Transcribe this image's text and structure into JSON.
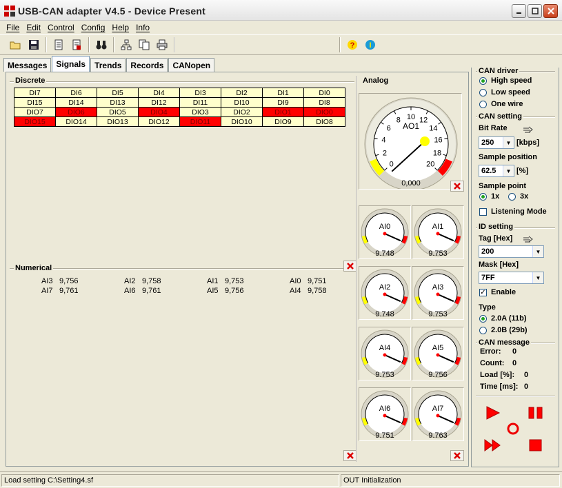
{
  "window": {
    "title": "USB-CAN adapter  V4.5  -  Device Present"
  },
  "menu": [
    "File",
    "Edit",
    "Control",
    "Config",
    "Help",
    "Info"
  ],
  "toolbar_icons": [
    "open-folder-icon",
    "save-icon",
    "open-doc-icon",
    "new-doc-icon",
    "binoculars-icon",
    "tree-icon",
    "copy-icon",
    "print-icon",
    "help-icon",
    "info-icon"
  ],
  "tabs": [
    "Messages",
    "Signals",
    "Trends",
    "Records",
    "CANopen"
  ],
  "active_tab": "Signals",
  "discrete": {
    "label": "Discrete",
    "rows": [
      [
        {
          "t": "DI7",
          "on": false
        },
        {
          "t": "DI6",
          "on": false
        },
        {
          "t": "DI5",
          "on": false
        },
        {
          "t": "DI4",
          "on": false
        },
        {
          "t": "DI3",
          "on": false
        },
        {
          "t": "DI2",
          "on": false
        },
        {
          "t": "DI1",
          "on": false
        },
        {
          "t": "DI0",
          "on": false
        }
      ],
      [
        {
          "t": "DI15",
          "on": false
        },
        {
          "t": "DI14",
          "on": false
        },
        {
          "t": "DI13",
          "on": false
        },
        {
          "t": "DI12",
          "on": false
        },
        {
          "t": "DI11",
          "on": false
        },
        {
          "t": "DI10",
          "on": false
        },
        {
          "t": "DI9",
          "on": false
        },
        {
          "t": "DI8",
          "on": false
        }
      ],
      [
        {
          "t": "DIO7",
          "on": false
        },
        {
          "t": "DIO6",
          "on": true
        },
        {
          "t": "DIO5",
          "on": false
        },
        {
          "t": "DIO4",
          "on": true
        },
        {
          "t": "DIO3",
          "on": false
        },
        {
          "t": "DIO2",
          "on": false
        },
        {
          "t": "DIO1",
          "on": true
        },
        {
          "t": "DIO0",
          "on": true
        }
      ],
      [
        {
          "t": "DIO15",
          "on": true
        },
        {
          "t": "DIO14",
          "on": false
        },
        {
          "t": "DIO13",
          "on": false
        },
        {
          "t": "DIO12",
          "on": false
        },
        {
          "t": "DIO11",
          "on": true
        },
        {
          "t": "DIO10",
          "on": false
        },
        {
          "t": "DIO9",
          "on": false
        },
        {
          "t": "DIO8",
          "on": false
        }
      ]
    ]
  },
  "numerical": {
    "label": "Numerical",
    "rows": [
      [
        {
          "n": "AI3",
          "v": "9,756"
        },
        {
          "n": "AI2",
          "v": "9,758"
        },
        {
          "n": "AI1",
          "v": "9,753"
        },
        {
          "n": "AI0",
          "v": "9,751"
        }
      ],
      [
        {
          "n": "AI7",
          "v": "9,761"
        },
        {
          "n": "AI6",
          "v": "9,761"
        },
        {
          "n": "AI5",
          "v": "9,756"
        },
        {
          "n": "AI4",
          "v": "9,758"
        }
      ]
    ]
  },
  "analog": {
    "label": "Analog",
    "big": {
      "name": "AO1",
      "value": "0,000",
      "scale": [
        "0",
        "2",
        "4",
        "6",
        "8",
        "10",
        "12",
        "14",
        "16",
        "18",
        "20"
      ],
      "min": 0,
      "max": 20,
      "reading": 0
    },
    "small": [
      {
        "name": "AI0",
        "value": "9.748"
      },
      {
        "name": "AI1",
        "value": "9.753"
      },
      {
        "name": "AI2",
        "value": "9.748"
      },
      {
        "name": "AI3",
        "value": "9.753"
      },
      {
        "name": "AI4",
        "value": "9.753"
      },
      {
        "name": "AI5",
        "value": "9.756"
      },
      {
        "name": "AI6",
        "value": "9.751"
      },
      {
        "name": "AI7",
        "value": "9.763"
      }
    ]
  },
  "side": {
    "can_driver": {
      "title": "CAN driver",
      "options": [
        "High speed",
        "Low speed",
        "One wire"
      ],
      "selected": 0
    },
    "can_setting": {
      "title": "CAN setting",
      "bitrate_label": "Bit Rate",
      "bitrate_value": "250",
      "bitrate_unit": "[kbps]",
      "sample_position_label": "Sample position",
      "sample_position_value": "62.5",
      "sample_position_unit": "[%]",
      "sample_point_label": "Sample point",
      "sample_point_options": [
        "1x",
        "3x"
      ],
      "sample_point_selected": 0,
      "listening_mode": "Listening Mode"
    },
    "id_setting": {
      "title": "ID setting",
      "tag_label": "Tag [Hex]",
      "tag_value": "200",
      "mask_label": "Mask [Hex]",
      "mask_value": "7FF",
      "enable_label": "Enable",
      "type_label": "Type",
      "type_options": [
        "2.0A (11b)",
        "2.0B (29b)"
      ],
      "type_selected": 0
    },
    "can_message": {
      "title": "CAN message",
      "error_label": "Error:",
      "error_value": "0",
      "count_label": "Count:",
      "count_value": "0",
      "load_label": "Load [%]:",
      "load_value": "0",
      "time_label": "Time [ms]:",
      "time_value": "0"
    }
  },
  "status": {
    "left": "Load setting C:\\Setting4.sf",
    "right": "OUT Initialization"
  },
  "colors": {
    "on": "#ff0000",
    "off": "#ffffcc",
    "gauge_yellow": "#ffff00",
    "gauge_red": "#ff0000",
    "play_red": "#ff0000"
  }
}
